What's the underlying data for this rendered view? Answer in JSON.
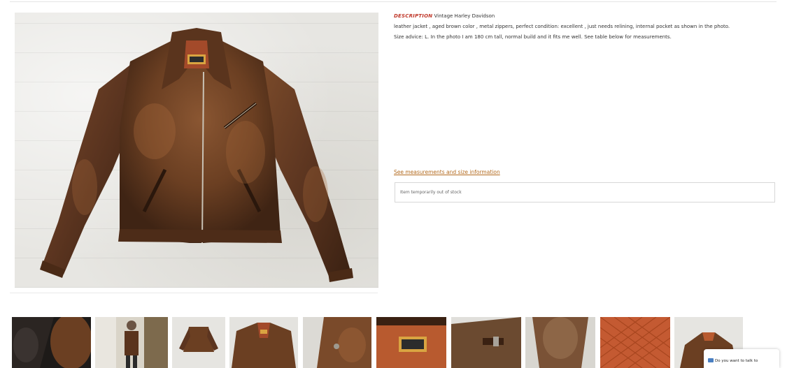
{
  "product": {
    "description_label": "DESCRIPTION",
    "description_title": "Vintage Harley Davidson",
    "description_line2": "leather jacket , aged brown color , metal zippers, perfect condition: excellent , just needs relining, internal pocket as shown in the photo.",
    "size_advice": "Size advice: L. In the photo I am 180 cm tall, normal build and it fits me well. See table below for measurements.",
    "size_link": "See measurements and size information",
    "stock_status": "Item temporarily out of stock"
  },
  "thumbnails": [
    {
      "name": "thumb-lining-closeup"
    },
    {
      "name": "thumb-worn-by-model"
    },
    {
      "name": "thumb-front-small"
    },
    {
      "name": "thumb-front-close"
    },
    {
      "name": "thumb-cuff-button"
    },
    {
      "name": "thumb-harley-label"
    },
    {
      "name": "thumb-side-buckle"
    },
    {
      "name": "thumb-collar-detail"
    },
    {
      "name": "thumb-quilted-lining"
    },
    {
      "name": "thumb-back-collar"
    }
  ],
  "chat": {
    "label": "Do you want to talk to",
    "icon": "chat-bubble-icon"
  },
  "colors": {
    "accent_red": "#c0392b",
    "link_brown": "#b36a1e",
    "leather": "#6b3f22"
  }
}
